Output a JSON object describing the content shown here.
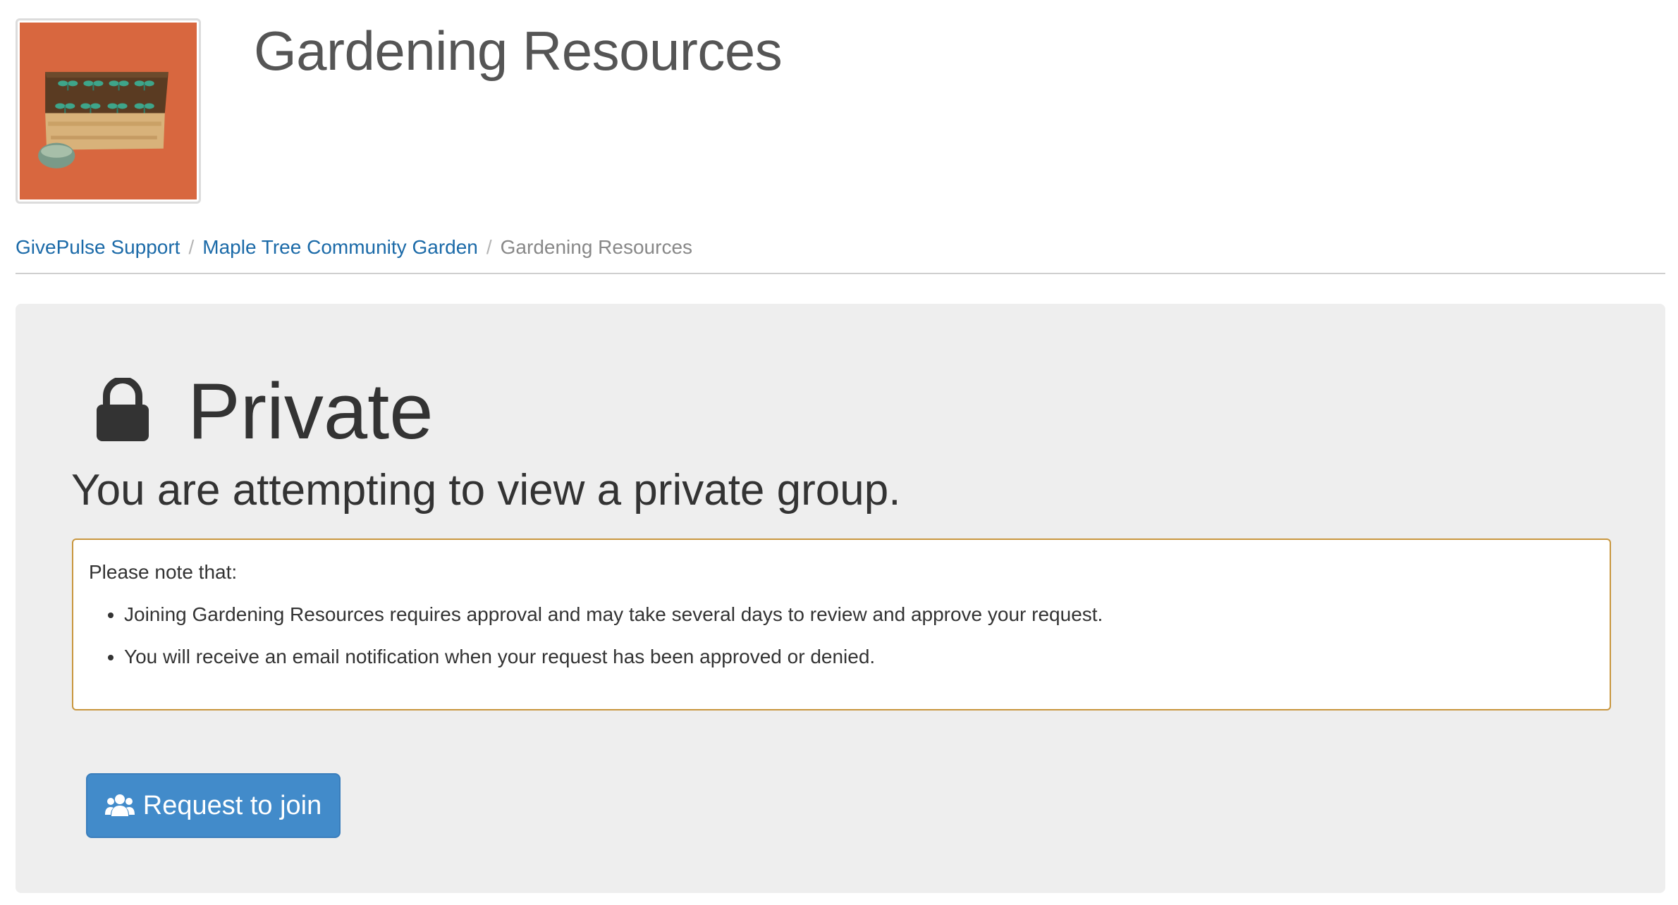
{
  "header": {
    "title": "Gardening Resources",
    "logo_icon": "garden-bed-logo",
    "logo_bg": "#d8673f"
  },
  "breadcrumb": [
    {
      "label": "GivePulse Support"
    },
    {
      "label": "Maple Tree Community Garden"
    },
    {
      "label": "Gardening Resources"
    }
  ],
  "breadcrumb_separator": "/",
  "main": {
    "lock_icon": "lock-icon",
    "title": "Private",
    "subtitle": "You are attempting to view a private group.",
    "note": {
      "intro": "Please note that:",
      "items": [
        "Joining Gardening Resources requires approval and may take several days to review and approve your request.",
        "You will receive an email notification when your request has been approved or denied."
      ]
    },
    "join_button": {
      "label": "Request to join",
      "icon": "users-icon",
      "color": "#428bca"
    }
  },
  "colors": {
    "link": "#1b6aa8",
    "panel_bg": "#eeeeee",
    "note_border": "#c8963e"
  }
}
